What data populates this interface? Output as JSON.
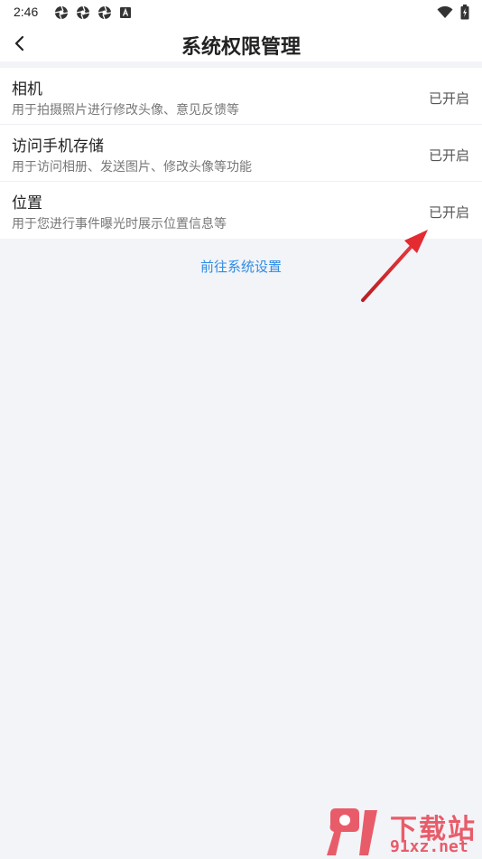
{
  "status_bar": {
    "time": "2:46",
    "left_icons": [
      "aperture-icon",
      "aperture-icon",
      "aperture-icon",
      "a-box-icon"
    ],
    "right_icons": [
      "wifi-icon",
      "battery-charging-icon"
    ]
  },
  "header": {
    "back_icon": "chevron-left-icon",
    "title": "系统权限管理"
  },
  "permissions": [
    {
      "title": "相机",
      "description": "用于拍摄照片进行修改头像、意见反馈等",
      "status": "已开启"
    },
    {
      "title": "访问手机存储",
      "description": "用于访问相册、发送图片、修改头像等功能",
      "status": "已开启"
    },
    {
      "title": "位置",
      "description": "用于您进行事件曝光时展示位置信息等",
      "status": "已开启"
    }
  ],
  "settings_link": "前往系统设置",
  "annotation": {
    "arrow_color": "#d8262c"
  },
  "watermark": {
    "top": "下载站",
    "bottom": "91xz.net",
    "color": "#e85c6a"
  },
  "colors": {
    "accent": "#2d8ce6",
    "background": "#f3f4f8"
  }
}
